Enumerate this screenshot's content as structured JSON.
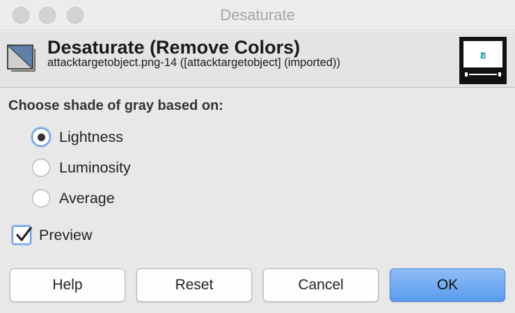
{
  "window": {
    "title": "Desaturate"
  },
  "header": {
    "title": "Desaturate (Remove Colors)",
    "subtitle": "attacktargetobject.png-14 ([attacktargetobject] (imported))"
  },
  "section": {
    "label": "Choose shade of gray based on:"
  },
  "options": [
    {
      "label": "Lightness",
      "selected": true
    },
    {
      "label": "Luminosity",
      "selected": false
    },
    {
      "label": "Average",
      "selected": false
    }
  ],
  "preview": {
    "label": "Preview",
    "checked": true
  },
  "buttons": {
    "help": "Help",
    "reset": "Reset",
    "cancel": "Cancel",
    "ok": "OK"
  },
  "colors": {
    "accent": "#4a82cf",
    "primary_button": "#5a9bee",
    "thumbnail_glyph": "#2a9bb5"
  },
  "icons": {
    "header": "desaturate-icon",
    "thumbnail": "image-preview-thumbnail"
  }
}
